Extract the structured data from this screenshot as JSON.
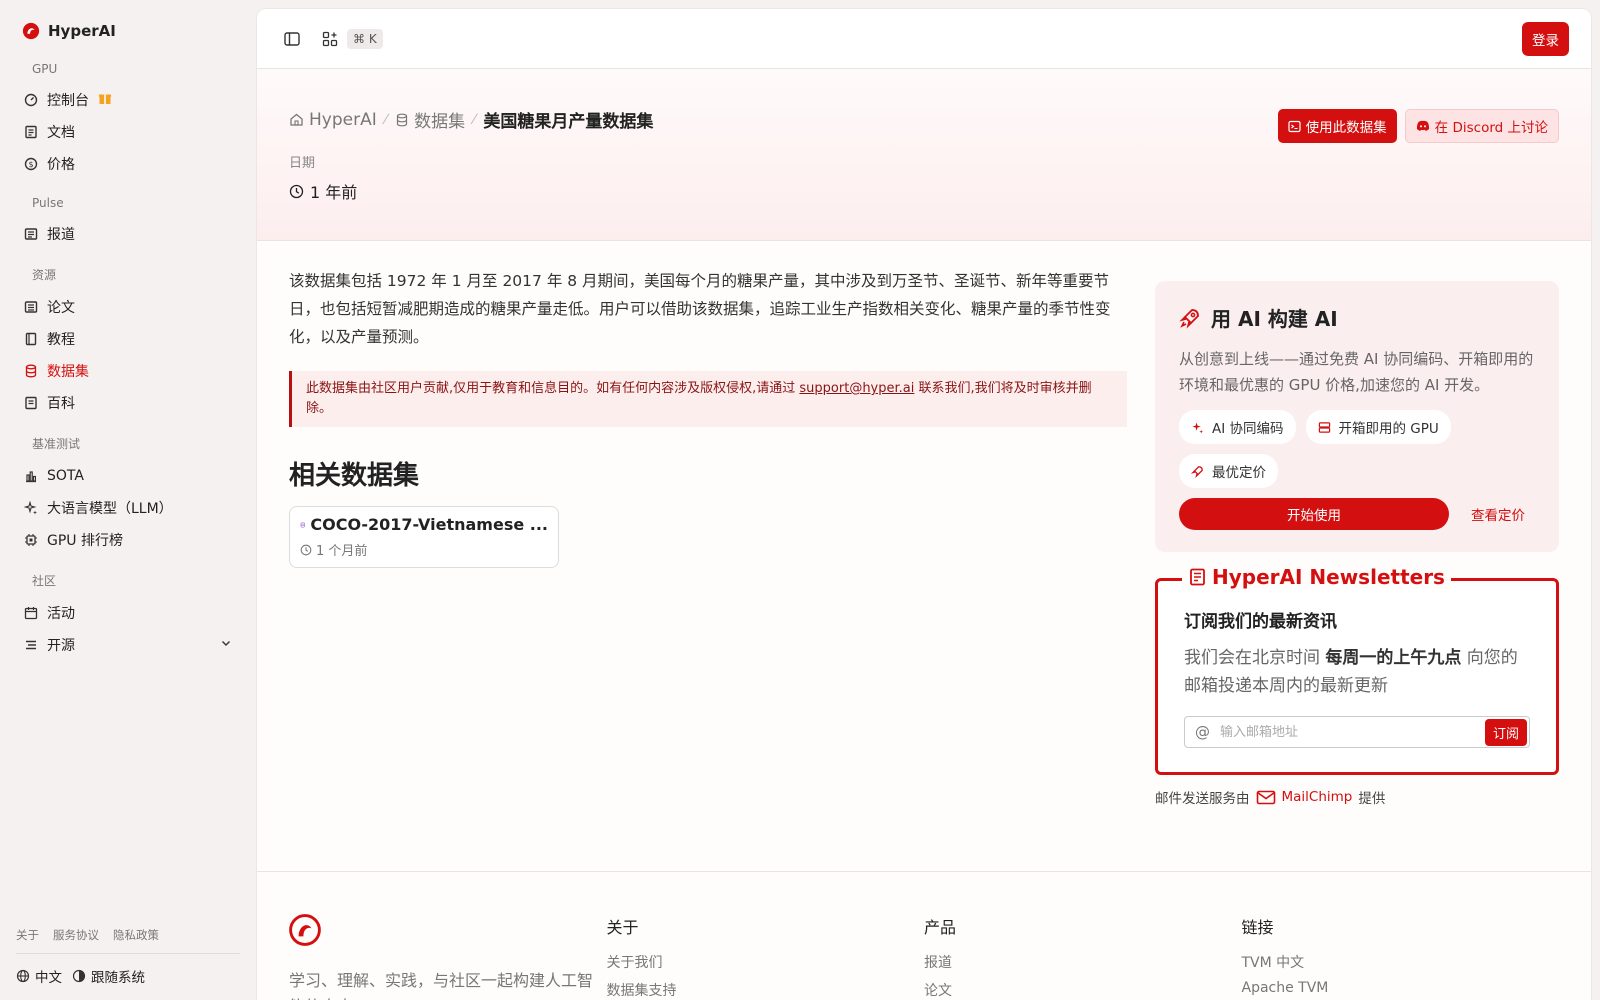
{
  "brand": {
    "name": "HyperAI",
    "accent": "#d40f0f"
  },
  "sidebar": {
    "sections": [
      {
        "title": "GPU",
        "items": [
          {
            "label": "控制台",
            "icon": "gauge-icon"
          },
          {
            "label": "文档",
            "icon": "doc-icon"
          },
          {
            "label": "价格",
            "icon": "dollar-icon"
          }
        ]
      },
      {
        "title": "Pulse",
        "items": [
          {
            "label": "报道",
            "icon": "news-icon"
          }
        ]
      },
      {
        "title": "资源",
        "items": [
          {
            "label": "论文",
            "icon": "paper-icon"
          },
          {
            "label": "教程",
            "icon": "book-icon"
          },
          {
            "label": "数据集",
            "icon": "database-icon",
            "active": true
          },
          {
            "label": "百科",
            "icon": "book-open-icon"
          }
        ]
      },
      {
        "title": "基准测试",
        "items": [
          {
            "label": "SOTA",
            "icon": "bar-chart-icon"
          },
          {
            "label": "大语言模型（LLM）",
            "icon": "sparkles-icon"
          },
          {
            "label": "GPU 排行榜",
            "icon": "cpu-icon"
          }
        ]
      },
      {
        "title": "社区",
        "items": [
          {
            "label": "活动",
            "icon": "calendar-icon"
          },
          {
            "label": "开源",
            "icon": "list-icon"
          }
        ]
      }
    ],
    "footer_links": [
      "关于",
      "服务协议",
      "隐私政策"
    ],
    "language": "中文",
    "theme": "跟随系统"
  },
  "topbar": {
    "shortcut": "⌘ K",
    "login": "登录"
  },
  "hero": {
    "crumbs": [
      "HyperAI",
      "数据集",
      "美国糖果月产量数据集"
    ],
    "use_btn": "使用此数据集",
    "discord_btn": "在 Discord 上讨论",
    "date_label": "日期",
    "date_value": "1 年前"
  },
  "content": {
    "description": "该数据集包括 1972 年 1 月至 2017 年 8 月期间，美国每个月的糖果产量，其中涉及到万圣节、圣诞节、新年等重要节日，也包括短暂减肥期造成的糖果产量走低。用户可以借助该数据集，追踪工业生产指数相关变化、糖果产量的季节性变化，以及产量预测。",
    "notice_before": "此数据集由社区用户贡献,仅用于教育和信息目的。如有任何内容涉及版权侵权,请通过 ",
    "notice_email": "support@hyper.ai",
    "notice_after": " 联系我们,我们将及时审核并删除。",
    "related_title": "相关数据集",
    "related": [
      {
        "title": "COCO-2017-Vietnamese ...",
        "date": "1 个月前"
      }
    ]
  },
  "ai_card": {
    "title": "用 AI 构建 AI",
    "description": "从创意到上线——通过免费 AI 协同编码、开箱即用的环境和最优惠的 GPU 价格,加速您的 AI 开发。",
    "chips": [
      "AI 协同编码",
      "开箱即用的 GPU",
      "最优定价"
    ],
    "start": "开始使用",
    "pricing": "查看定价"
  },
  "newsletter": {
    "legend": "HyperAI Newsletters",
    "heading": "订阅我们的最新资讯",
    "text_before": "我们会在北京时间 ",
    "text_bold": "每周一的上午九点",
    "text_after": " 向您的邮箱投递本周内的最新更新",
    "placeholder": "输入邮箱地址",
    "subscribe": "订阅",
    "provider_before": "邮件发送服务由",
    "provider": "MailChimp",
    "provider_after": "提供"
  },
  "footer": {
    "tagline": "学习、理解、实践，与社区一起构建人工智能的未来",
    "columns": [
      {
        "title": "关于",
        "links": [
          "关于我们",
          "数据集支持"
        ]
      },
      {
        "title": "产品",
        "links": [
          "报道",
          "论文"
        ]
      },
      {
        "title": "链接",
        "links": [
          "TVM 中文",
          "Apache TVM"
        ]
      }
    ]
  }
}
